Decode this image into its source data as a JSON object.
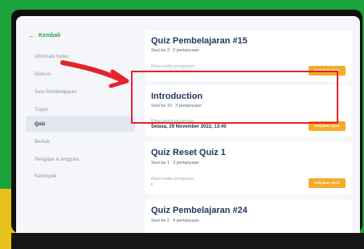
{
  "colors": {
    "accent_green": "#27a84a",
    "button_orange": "#f7a928",
    "highlight_red": "#e3242b",
    "frame_green": "#1aa33a"
  },
  "sidebar": {
    "back_label": "Kembali",
    "items": [
      {
        "label": "Informasi Kelas"
      },
      {
        "label": "Diskusi"
      },
      {
        "label": "Sesi Pembelajaran"
      },
      {
        "label": "Tugas"
      },
      {
        "label": "Quiz"
      },
      {
        "label": "Berkas"
      },
      {
        "label": "Pengajar & Anggota"
      },
      {
        "label": "Kelompok"
      }
    ]
  },
  "quizzes": [
    {
      "title": "Quiz Pembelajaran #15",
      "session": "Sesi ke 3",
      "questions": "2 pertanyaan",
      "deadline_label": "Batas waktu pengerjaan",
      "deadline": "-",
      "button": "Kerjakan Quiz"
    },
    {
      "title": "Introduction",
      "session": "Sesi ke 10",
      "questions": "3 pertanyaan",
      "deadline_label": "Batas waktu pengerjaan",
      "deadline": "Selasa, 29 November 2022, 13:45",
      "button": "Kerjakan Quiz"
    },
    {
      "title": "Quiz Reset Quiz 1",
      "session": "Sesi ke 1",
      "questions": "3 pertanyaan",
      "deadline_label": "Batas waktu pengerjaan",
      "deadline": "-",
      "button": "Kerjakan Quiz"
    },
    {
      "title": "Quiz Pembelajaran #24",
      "session": "Sesi ke 2",
      "questions": "4 pertanyaan"
    }
  ]
}
